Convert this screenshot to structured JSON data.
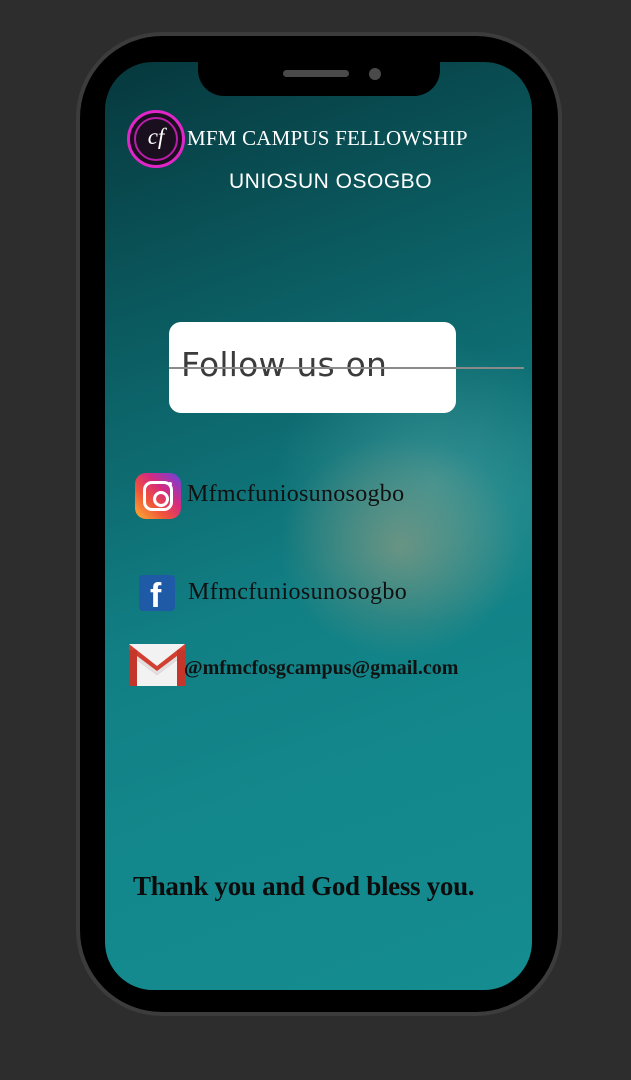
{
  "header": {
    "logo_text": "cf",
    "title": "MFM CAMPUS FELLOWSHIP",
    "subtitle": "UNIOSUN OSOGBO"
  },
  "follow": {
    "label": "Follow us on"
  },
  "socials": {
    "instagram": {
      "icon": "instagram-icon",
      "handle": "Mfmcfuniosunosogbo"
    },
    "facebook": {
      "icon": "facebook-icon",
      "handle": "Mfmcfuniosunosogbo"
    },
    "gmail": {
      "icon": "gmail-icon",
      "address": "@mfmcfosgcampus@gmail.com"
    }
  },
  "footer": {
    "message": "Thank you and God bless you."
  },
  "colors": {
    "background": "#2d2d2d",
    "screen_top": "#06383d",
    "screen_bottom": "#148c90",
    "logo_accent": "#e026c8",
    "facebook_blue": "#1f5aa6",
    "gmail_red": "#d23f31"
  }
}
